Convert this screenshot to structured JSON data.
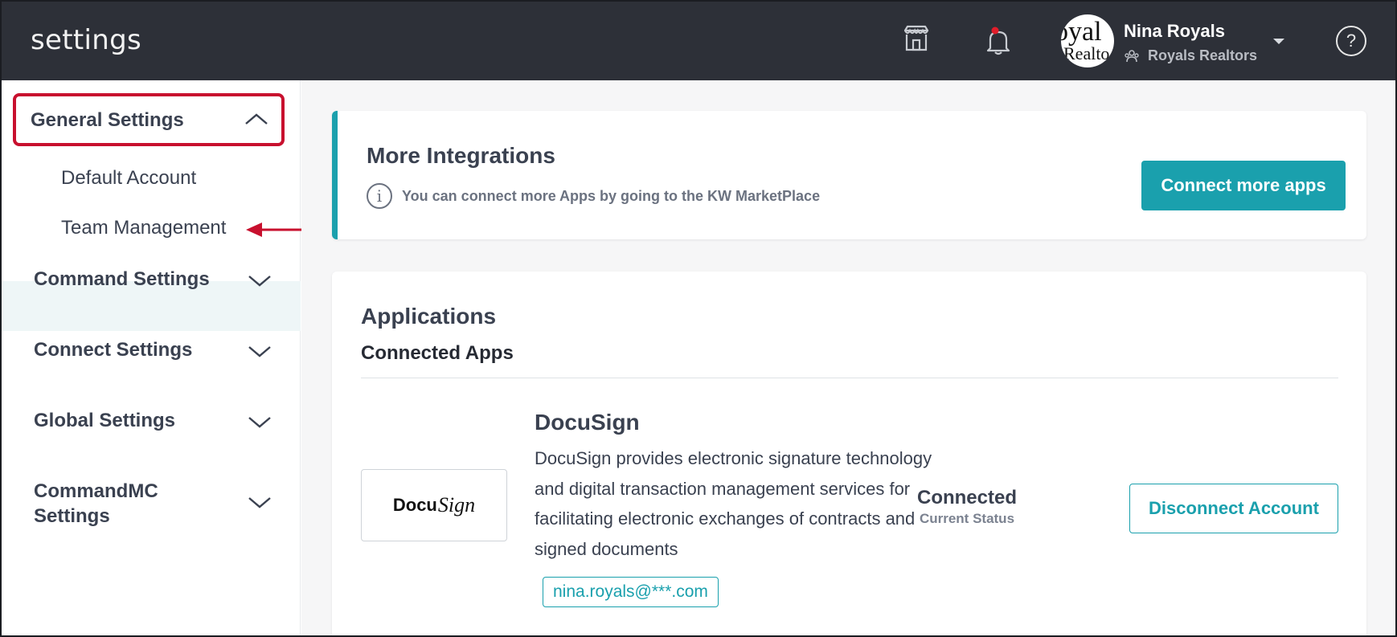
{
  "header": {
    "title": "settings",
    "user": {
      "name": "Nina Royals",
      "org": "Royals Realtors",
      "avatar_text_top": "oyal",
      "avatar_text_bottom": "Realto"
    },
    "help_label": "?"
  },
  "sidebar": {
    "sections": [
      {
        "label": "General Settings",
        "expanded": true,
        "items": [
          "Default Account",
          "Team Management"
        ]
      },
      {
        "label": "Command Settings",
        "expanded": false
      },
      {
        "label": "Connect Settings",
        "expanded": false
      },
      {
        "label": "Global Settings",
        "expanded": false
      },
      {
        "label": "CommandMC Settings",
        "label_line1": "CommandMC",
        "label_line2": "Settings",
        "expanded": false
      }
    ],
    "selected_item": "Team Management"
  },
  "integrations": {
    "title": "More Integrations",
    "info_text": "You can connect more Apps by going to the KW MarketPlace",
    "button_label": "Connect more apps"
  },
  "applications": {
    "title": "Applications",
    "subtitle": "Connected Apps",
    "apps": [
      {
        "logo_text_bold": "Docu",
        "logo_text_script": "Sign",
        "name": "DocuSign",
        "description": "DocuSign provides electronic signature technology and digital transaction management services for facilitating electronic exchanges of contracts and signed documents",
        "email": "nina.royals@***.com",
        "status": "Connected",
        "status_label": "Current Status",
        "action_label": "Disconnect Account"
      }
    ]
  },
  "colors": {
    "accent": "#1aa0ad",
    "header_bg": "#2d3038",
    "annotation": "#c8102e",
    "notification_dot": "#e11d2a"
  }
}
